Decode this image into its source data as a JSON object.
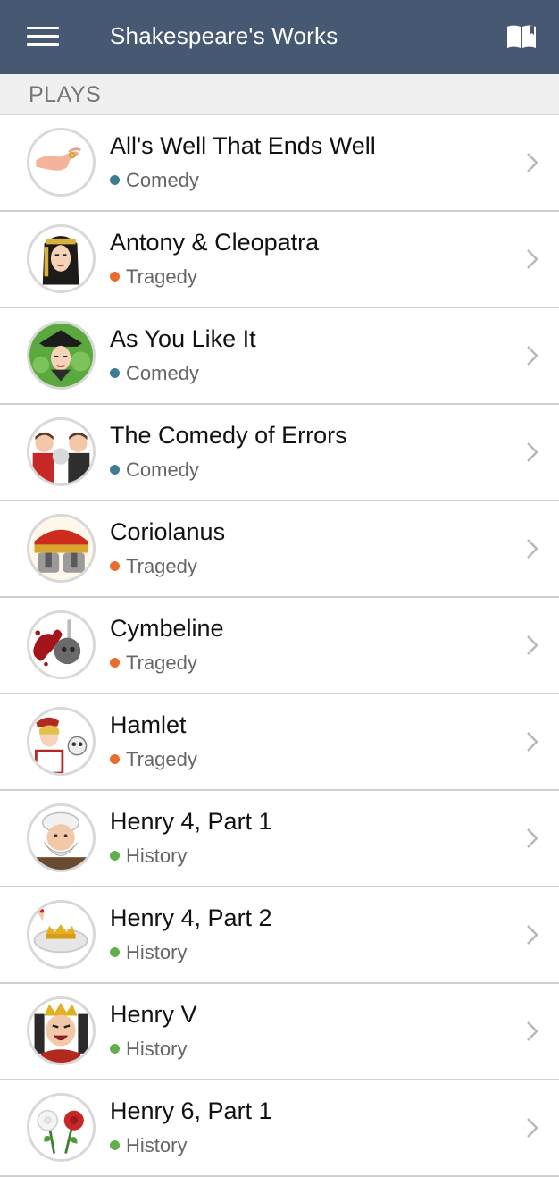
{
  "app": {
    "title": "Shakespeare's Works"
  },
  "section": {
    "title": "PLAYS"
  },
  "colors": {
    "appbar": "#475872",
    "comedy": "#3d7d94",
    "tragedy": "#ea6b2e",
    "history": "#5fb04b"
  },
  "plays": [
    {
      "title": "All's Well That Ends Well",
      "genre": "Comedy",
      "icon": "hand-ring-icon"
    },
    {
      "title": "Antony & Cleopatra",
      "genre": "Tragedy",
      "icon": "cleopatra-icon"
    },
    {
      "title": "As You Like It",
      "genre": "Comedy",
      "icon": "forest-character-icon"
    },
    {
      "title": "The Comedy of Errors",
      "genre": "Comedy",
      "icon": "twins-icon"
    },
    {
      "title": "Coriolanus",
      "genre": "Tragedy",
      "icon": "roman-helmets-icon"
    },
    {
      "title": "Cymbeline",
      "genre": "Tragedy",
      "icon": "blood-splatter-icon"
    },
    {
      "title": "Hamlet",
      "genre": "Tragedy",
      "icon": "hamlet-skull-icon"
    },
    {
      "title": "Henry 4, Part 1",
      "genre": "History",
      "icon": "falstaff-icon"
    },
    {
      "title": "Henry 4, Part 2",
      "genre": "History",
      "icon": "crown-bowl-icon"
    },
    {
      "title": "Henry V",
      "genre": "History",
      "icon": "king-henry-icon"
    },
    {
      "title": "Henry 6, Part 1",
      "genre": "History",
      "icon": "roses-icon"
    }
  ]
}
